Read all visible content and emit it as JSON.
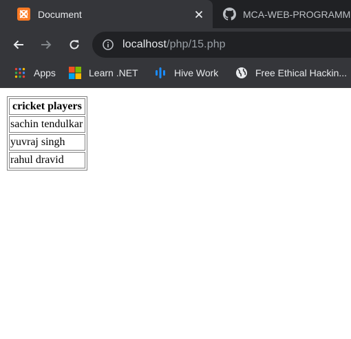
{
  "tabs": [
    {
      "title": "Document",
      "active": true,
      "icon": "xampp-icon"
    },
    {
      "title": "MCA-WEB-PROGRAMMING",
      "active": false,
      "icon": "github-icon"
    }
  ],
  "toolbar": {
    "url_host": "localhost",
    "url_path": "/php/15.php"
  },
  "bookmarks": [
    {
      "label": "Apps",
      "icon": "apps-grid-icon"
    },
    {
      "label": "Learn .NET",
      "icon": "microsoft-icon"
    },
    {
      "label": "Hive Work",
      "icon": "hive-icon"
    },
    {
      "label": "Free Ethical Hackin...",
      "icon": "globe-icon"
    }
  ],
  "table": {
    "header": "cricket players",
    "rows": [
      "sachin tendulkar",
      "yuvraj singh",
      "rahul dravid"
    ]
  },
  "colors": {
    "tabstrip": "#202124",
    "toolbar": "#35363a",
    "omnibox": "#202124",
    "xampp": "#fb7a24"
  }
}
